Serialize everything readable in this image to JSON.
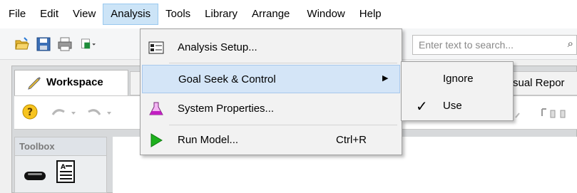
{
  "menubar": {
    "items": [
      "File",
      "Edit",
      "View",
      "Analysis",
      "Tools",
      "Library",
      "Arrange",
      "Window",
      "Help"
    ],
    "active": "Analysis"
  },
  "search": {
    "placeholder": "Enter text to search..."
  },
  "tabs": {
    "workspace": "Workspace",
    "visual_report_partial": "sual Repor"
  },
  "toolbox": {
    "title": "Toolbox"
  },
  "analysis_menu": {
    "items": [
      {
        "label": "Analysis Setup...",
        "icon": "analysis-setup-icon"
      },
      {
        "label": "Goal Seek & Control",
        "icon": "",
        "has_submenu": true
      },
      {
        "label": "System Properties...",
        "icon": "flask-icon"
      },
      {
        "label": "Run Model...",
        "icon": "run-icon",
        "shortcut": "Ctrl+R"
      }
    ]
  },
  "goal_seek_submenu": {
    "items": [
      {
        "label": "Ignore",
        "checked": false
      },
      {
        "label": "Use",
        "checked": true
      }
    ],
    "check_glyph": "✓"
  },
  "colors": {
    "menu_highlight": "#d4e5f7",
    "active_menu": "#cce4f7",
    "run_icon_green": "#1db01d",
    "flask_magenta": "#c21ec2"
  }
}
